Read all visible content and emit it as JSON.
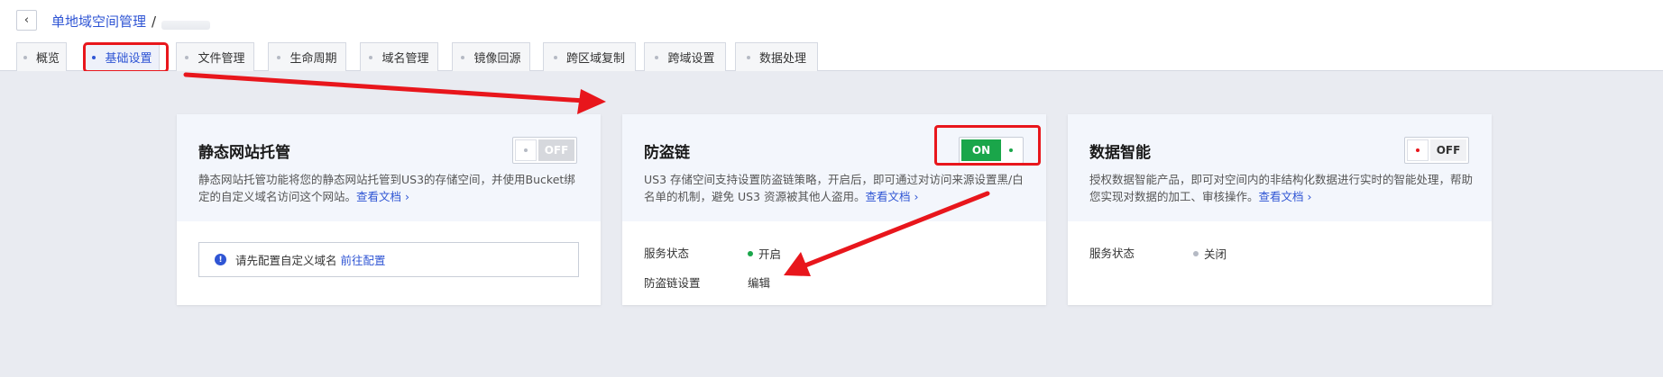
{
  "breadcrumb": {
    "back": "‹",
    "parent": "单地域空间管理",
    "separator": "/"
  },
  "tabs": [
    {
      "label": "概览",
      "active": false
    },
    {
      "label": "基础设置",
      "active": true
    },
    {
      "label": "文件管理",
      "active": false
    },
    {
      "label": "生命周期",
      "active": false
    },
    {
      "label": "域名管理",
      "active": false
    },
    {
      "label": "镜像回源",
      "active": false
    },
    {
      "label": "跨区域复制",
      "active": false
    },
    {
      "label": "跨域设置",
      "active": false
    },
    {
      "label": "数据处理",
      "active": false
    }
  ],
  "cards": {
    "static_site": {
      "title": "静态网站托管",
      "toggle": "OFF",
      "desc": "静态网站托管功能将您的静态网站托管到US3的存储空间，并使用Bucket绑定的自定义域名访问这个网站。",
      "doc_link": "查看文档 ›",
      "notice_text": "请先配置自定义域名",
      "notice_link": "前往配置"
    },
    "hotlink": {
      "title": "防盗链",
      "toggle": "ON",
      "desc": "US3 存储空间支持设置防盗链策略，开启后，即可通过对访问来源设置黑/白名单的机制，避免 US3 资源被其他人盗用。",
      "doc_link": "查看文档 ›",
      "status_label": "服务状态",
      "status_value": "开启",
      "setting_label": "防盗链设置",
      "setting_link": "编辑"
    },
    "data_ai": {
      "title": "数据智能",
      "toggle": "OFF",
      "desc": "授权数据智能产品，即可对空间内的非结构化数据进行实时的智能处理，帮助您实现对数据的加工、审核操作。",
      "doc_link": "查看文档 ›",
      "status_label": "服务状态",
      "status_value": "关闭"
    }
  },
  "colors": {
    "accent": "#2f55d4",
    "on_green": "#1aa64a",
    "annotation_red": "#e8161c",
    "off_gray": "#b5bac4"
  }
}
